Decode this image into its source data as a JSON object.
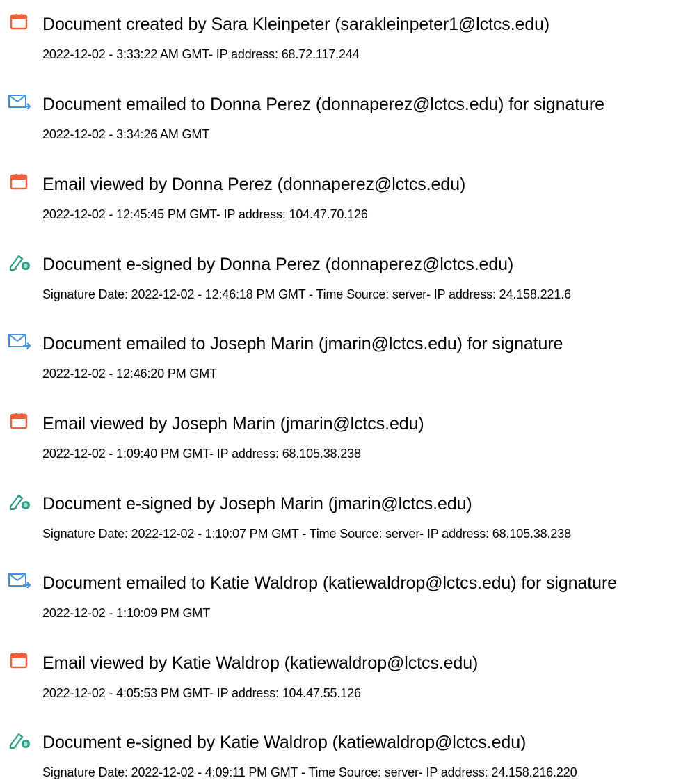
{
  "colors": {
    "doc_icon": "#e8603c",
    "mail_icon": "#4a8ed6",
    "sign_icon": "#2e9e8a",
    "text": "#000000"
  },
  "entries": [
    {
      "icon": "document-icon",
      "title": "Document created by Sara Kleinpeter (sarakleinpeter1@lctcs.edu)",
      "meta": "2022-12-02 - 3:33:22 AM GMT- IP address: 68.72.117.244"
    },
    {
      "icon": "email-icon",
      "title": "Document emailed to Donna Perez (donnaperez@lctcs.edu) for signature",
      "meta": "2022-12-02 - 3:34:26 AM GMT"
    },
    {
      "icon": "document-icon",
      "title": "Email viewed by Donna Perez (donnaperez@lctcs.edu)",
      "meta": "2022-12-02 - 12:45:45 PM GMT- IP address: 104.47.70.126"
    },
    {
      "icon": "esign-pen-icon",
      "title": "Document e-signed by Donna Perez (donnaperez@lctcs.edu)",
      "meta": "Signature Date: 2022-12-02 - 12:46:18 PM GMT - Time Source: server- IP address: 24.158.221.6"
    },
    {
      "icon": "email-icon",
      "title": "Document emailed to Joseph Marin (jmarin@lctcs.edu) for signature",
      "meta": "2022-12-02 - 12:46:20 PM GMT"
    },
    {
      "icon": "document-icon",
      "title": "Email viewed by Joseph Marin (jmarin@lctcs.edu)",
      "meta": "2022-12-02 - 1:09:40 PM GMT- IP address: 68.105.38.238"
    },
    {
      "icon": "esign-pen-icon",
      "title": "Document e-signed by Joseph Marin (jmarin@lctcs.edu)",
      "meta": "Signature Date: 2022-12-02 - 1:10:07 PM GMT - Time Source: server- IP address: 68.105.38.238"
    },
    {
      "icon": "email-icon",
      "title": "Document emailed to Katie Waldrop (katiewaldrop@lctcs.edu) for signature",
      "meta": "2022-12-02 - 1:10:09 PM GMT"
    },
    {
      "icon": "document-icon",
      "title": "Email viewed by Katie Waldrop (katiewaldrop@lctcs.edu)",
      "meta": "2022-12-02 - 4:05:53 PM GMT- IP address: 104.47.55.126"
    },
    {
      "icon": "esign-pen-icon",
      "title": "Document e-signed by Katie Waldrop (katiewaldrop@lctcs.edu)",
      "meta": "Signature Date: 2022-12-02 - 4:09:11 PM GMT - Time Source: server- IP address: 24.158.216.220"
    }
  ]
}
